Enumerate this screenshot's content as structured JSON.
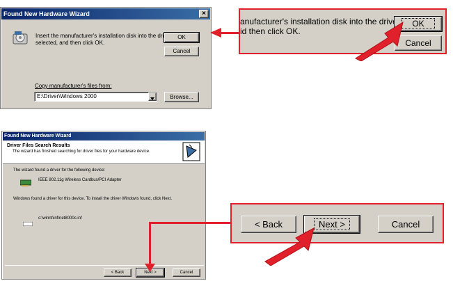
{
  "dialog1": {
    "title": "Found New Hardware Wizard",
    "close_glyph": "×",
    "instruction_line1": "Insert the manufacturer's installation disk into the drive",
    "instruction_line2": "selected, and then click OK.",
    "ok_label": "OK",
    "cancel_label": "Cancel",
    "copy_label": "Copy manufacturer's files from:",
    "path_value": "E:\\Driver\\Windows 2000",
    "browse_label": "Browse..."
  },
  "zoom1": {
    "line1": "anufacturer's installation disk into the drive",
    "line2": "id then click OK.",
    "ok_label": "OK",
    "cancel_label": "Cancel"
  },
  "dialog2": {
    "title": "Found New Hardware Wizard",
    "header_title": "Driver Files Search Results",
    "header_subtitle": "The wizard has finished searching for driver files for your hardware device.",
    "found_text": "The wizard found a driver for the following device:",
    "device_name": "IEEE 802.11g Wireless Cardbus/PCI Adapter",
    "install_text": "Windows found a driver for this device. To install the driver Windows found, click Next.",
    "driver_path": "c:\\winnt\\inf\\net8000c.inf",
    "back_label": "< Back",
    "next_label": "Next >",
    "cancel_label": "Cancel"
  },
  "zoom2": {
    "back_label": "< Back",
    "next_label": "Next >",
    "cancel_label": "Cancel"
  },
  "colors": {
    "highlight_red": "#e0202a",
    "dialog_gray": "#d4d0c8",
    "title_blue": "#0a246a"
  }
}
